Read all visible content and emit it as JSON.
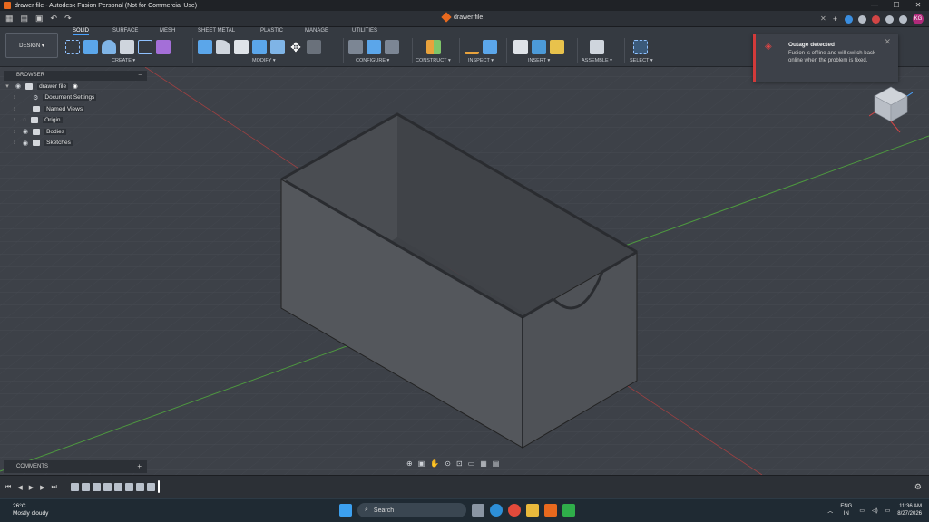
{
  "window": {
    "title": "drawer file - Autodesk Fusion Personal (Not for Commercial Use)",
    "controls": [
      "—",
      "☐",
      "✕"
    ]
  },
  "doc_tab": {
    "name": "drawer file",
    "close": "✕"
  },
  "ribbon": {
    "workspace": "DESIGN ▾",
    "tabs": [
      "SOLID",
      "SURFACE",
      "MESH",
      "SHEET METAL",
      "PLASTIC",
      "MANAGE",
      "UTILITIES"
    ],
    "groups": [
      "CREATE ▾",
      "MODIFY ▾",
      "CONFIGURE ▾",
      "CONSTRUCT ▾",
      "INSPECT ▾",
      "INSERT ▾",
      "ASSEMBLE ▾",
      "SELECT ▾"
    ]
  },
  "browser": {
    "header": "BROWSER",
    "items": [
      {
        "label": "drawer file",
        "icon": "document-icon"
      },
      {
        "label": "Document Settings",
        "icon": "gear-icon"
      },
      {
        "label": "Named Views",
        "icon": "folder-icon"
      },
      {
        "label": "Origin",
        "icon": "folder-icon"
      },
      {
        "label": "Bodies",
        "icon": "folder-icon"
      },
      {
        "label": "Sketches",
        "icon": "folder-icon"
      }
    ]
  },
  "notification": {
    "title": "Outage detected",
    "body": "Fusion is offline and will switch back online when the problem is fixed."
  },
  "comments": {
    "label": "COMMENTS",
    "plus": "+"
  },
  "taskbar": {
    "temp": "26°C",
    "weather": "Mostly cloudy",
    "search_placeholder": "Search",
    "lang": "ENG",
    "region": "IN",
    "time": "11:36 AM",
    "date": "8/27/2026"
  },
  "user": {
    "initials": "KG"
  },
  "colors": {
    "accent": "#4aa3ff",
    "alert": "#d23a3a",
    "app": "#e8691e"
  }
}
